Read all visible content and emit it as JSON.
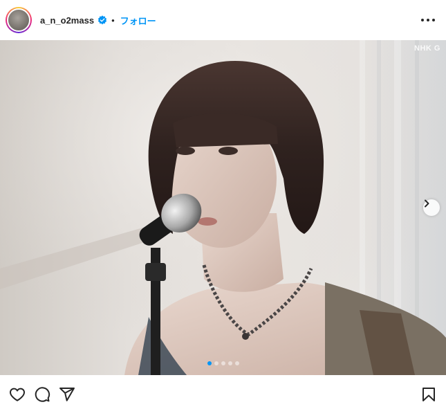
{
  "header": {
    "username": "a_n_o2mass",
    "separator": "•",
    "follow_label": "フォロー",
    "verified": true
  },
  "media": {
    "watermark": "NHK G",
    "carousel_total": 5,
    "carousel_active": 1
  },
  "actions": {
    "icons": [
      "heart-icon",
      "comment-icon",
      "share-icon",
      "bookmark-icon"
    ]
  },
  "colors": {
    "accent": "#0095f6",
    "text": "#262626"
  }
}
